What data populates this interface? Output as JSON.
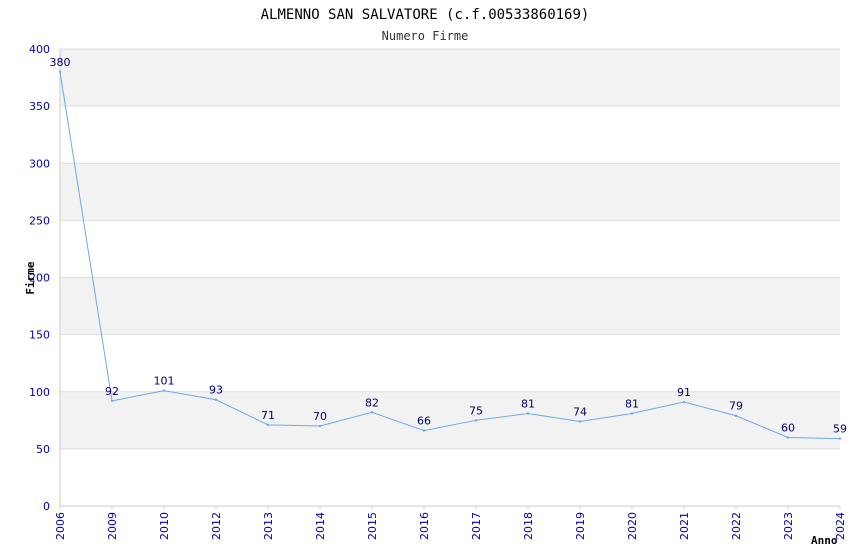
{
  "chart_data": {
    "type": "line",
    "title": "ALMENNO SAN SALVATORE (c.f.00533860169)",
    "subtitle": "Numero Firme",
    "xlabel": "Anno",
    "ylabel": "Firme",
    "categories": [
      "2006",
      "2009",
      "2010",
      "2012",
      "2013",
      "2014",
      "2015",
      "2016",
      "2017",
      "2018",
      "2019",
      "2020",
      "2021",
      "2022",
      "2023",
      "2024"
    ],
    "series": [
      {
        "values": [
          380,
          92,
          101,
          93,
          71,
          70,
          82,
          66,
          75,
          81,
          74,
          81,
          91,
          79,
          60,
          59
        ]
      }
    ],
    "ylim": [
      0,
      400
    ],
    "yticks": [
      0,
      50,
      100,
      150,
      200,
      250,
      300,
      350,
      400
    ],
    "grid": true,
    "colors": {
      "line": "#6fa8e8",
      "band": "#f2f2f2",
      "grid": "#dddddd",
      "tick_text": "#0000aa",
      "data_label": "#000066"
    }
  }
}
